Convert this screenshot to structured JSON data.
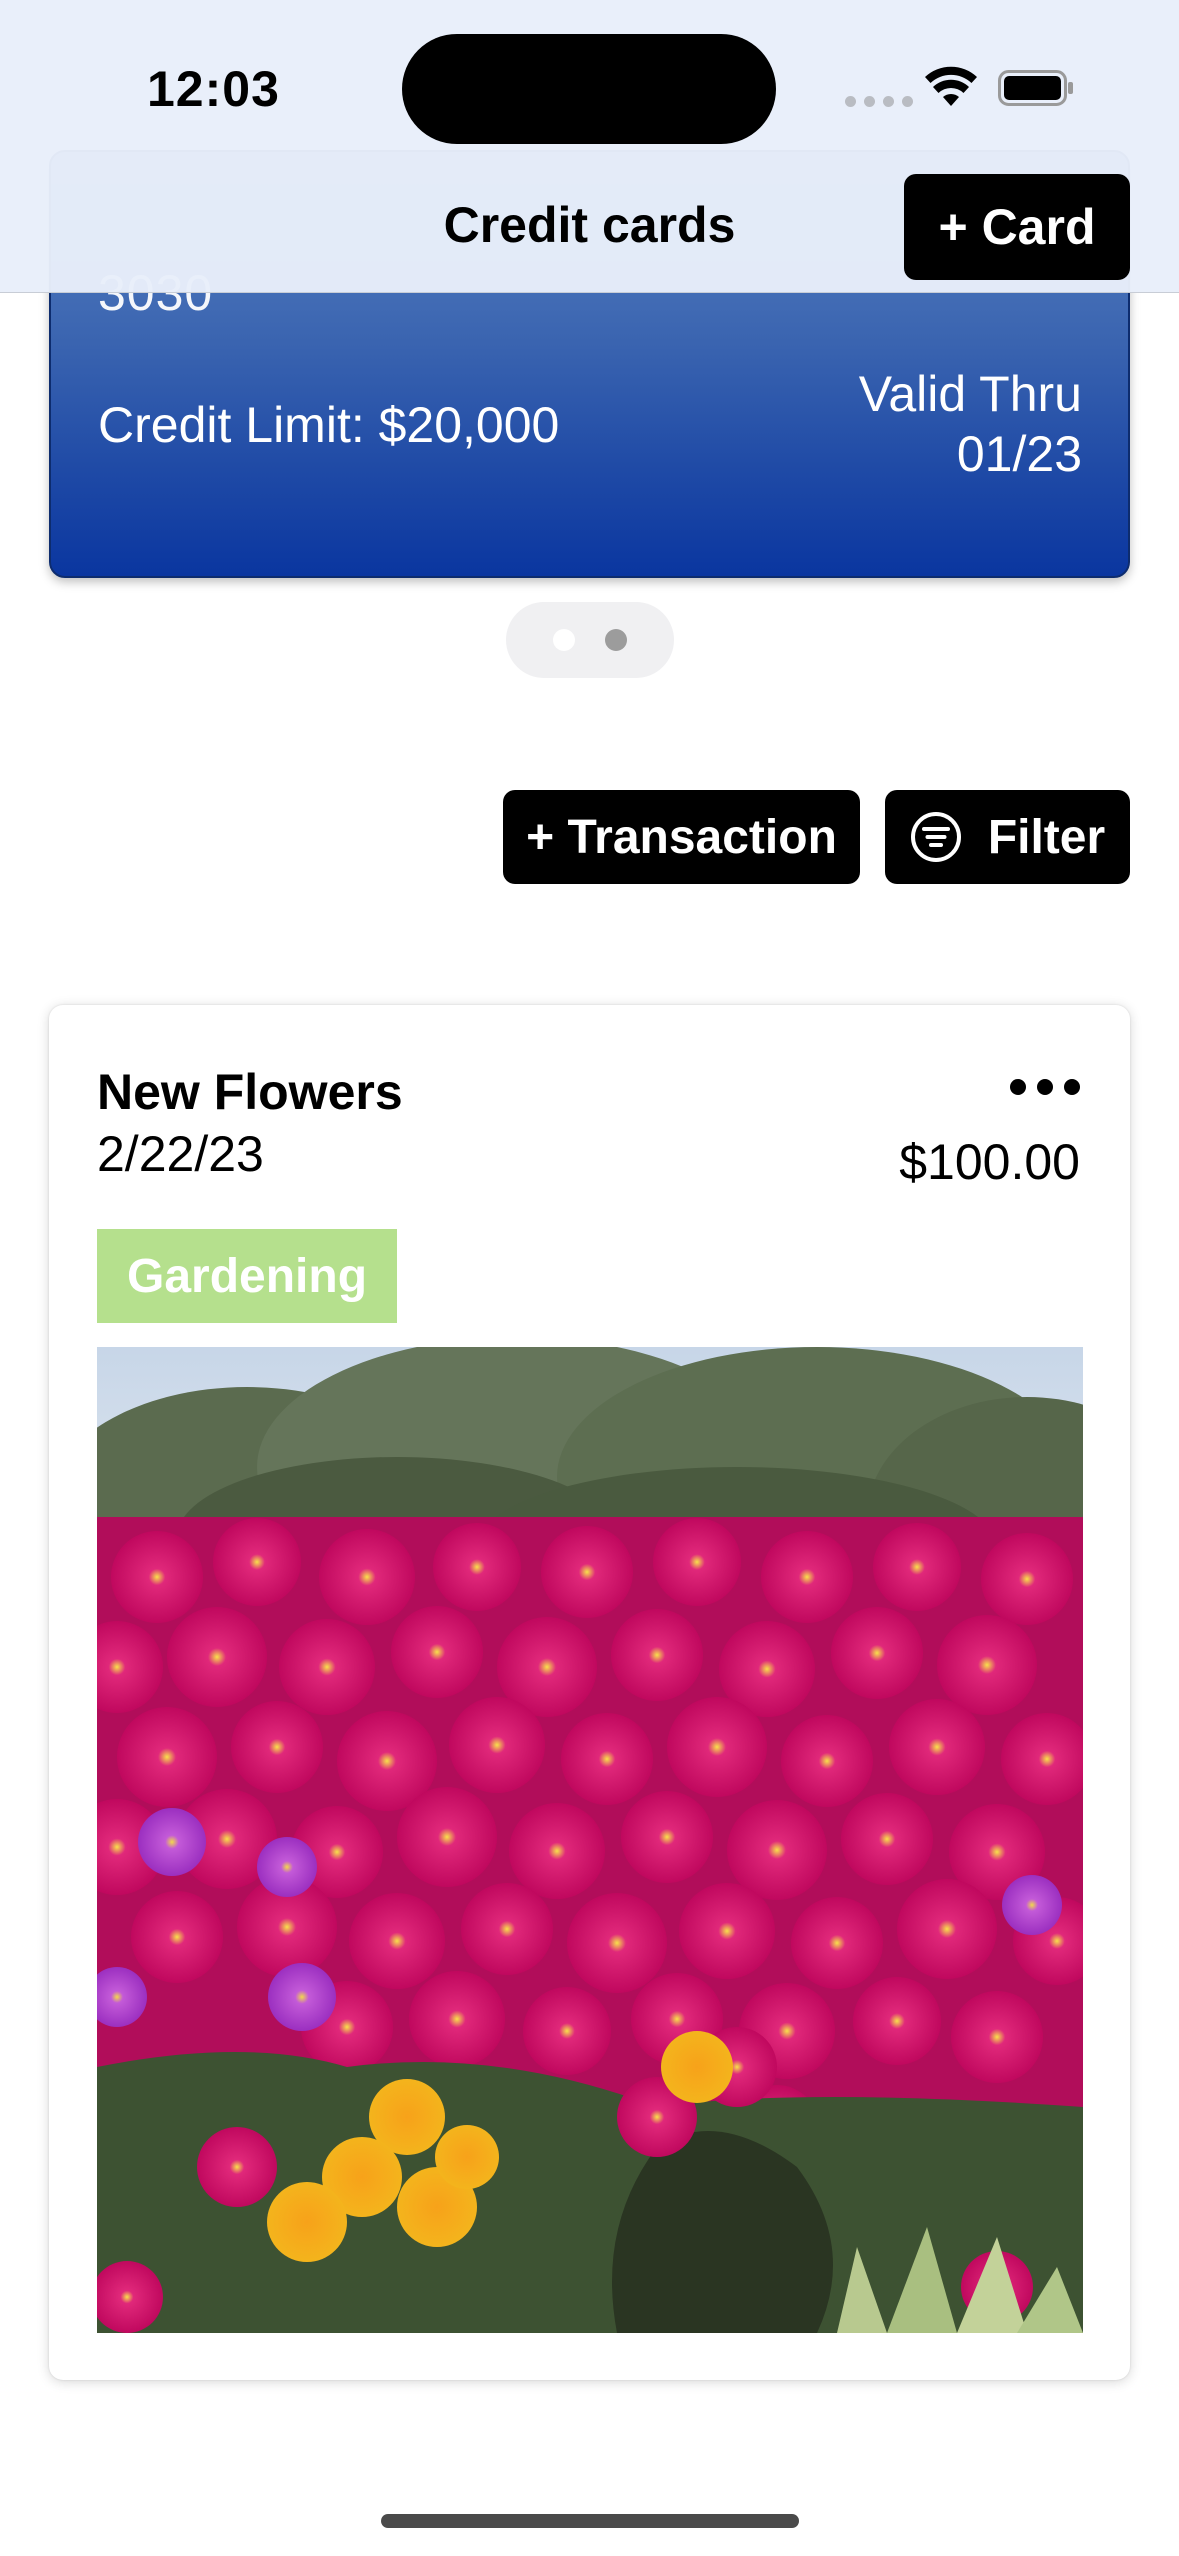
{
  "status_bar": {
    "time": "12:03"
  },
  "nav": {
    "title": "Credit cards",
    "add_card_label": "+ Card"
  },
  "credit_card": {
    "number_fragment": "3030",
    "credit_limit": "Credit Limit: $20,000",
    "valid_thru_label": "Valid Thru",
    "valid_thru_date": "01/23"
  },
  "pager": {
    "pages": 2,
    "current": 2
  },
  "actions": {
    "add_transaction_label": "+ Transaction",
    "filter_label": "Filter"
  },
  "transactions": [
    {
      "title": "New Flowers",
      "date": "2/22/23",
      "amount": "$100.00",
      "tag": "Gardening",
      "tag_color": "#b5e08d",
      "photo": "flowers-photo"
    }
  ],
  "colors": {
    "card_gradient_top": "#5b84c4",
    "card_gradient_bottom": "#0a36a0",
    "button_bg": "#000000"
  }
}
